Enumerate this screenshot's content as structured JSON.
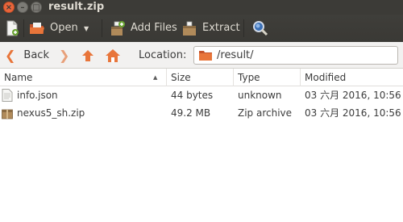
{
  "window": {
    "title": "result.zip",
    "close_glyph": "×",
    "min_glyph": "–",
    "max_glyph": "□"
  },
  "toolbar": {
    "open_label": "Open",
    "add_files_label": "Add Files",
    "extract_label": "Extract"
  },
  "location": {
    "back_label": "Back",
    "location_label": "Location:",
    "path": "/result/"
  },
  "table": {
    "columns": [
      "Name",
      "Size",
      "Type",
      "Modified"
    ],
    "rows": [
      {
        "name": "info.json",
        "size": "44 bytes",
        "type": "unknown",
        "modified": "03 六月 2016, 10:56",
        "icon": "text-file-icon"
      },
      {
        "name": "nexus5_sh.zip",
        "size": "49.2 MB",
        "type": "Zip archive",
        "modified": "03 六月 2016, 10:56",
        "icon": "archive-file-icon"
      }
    ]
  },
  "colors": {
    "titlebar": "#3c3b37",
    "accent_orange": "#e9653b",
    "folder_orange": "#e8753a"
  }
}
